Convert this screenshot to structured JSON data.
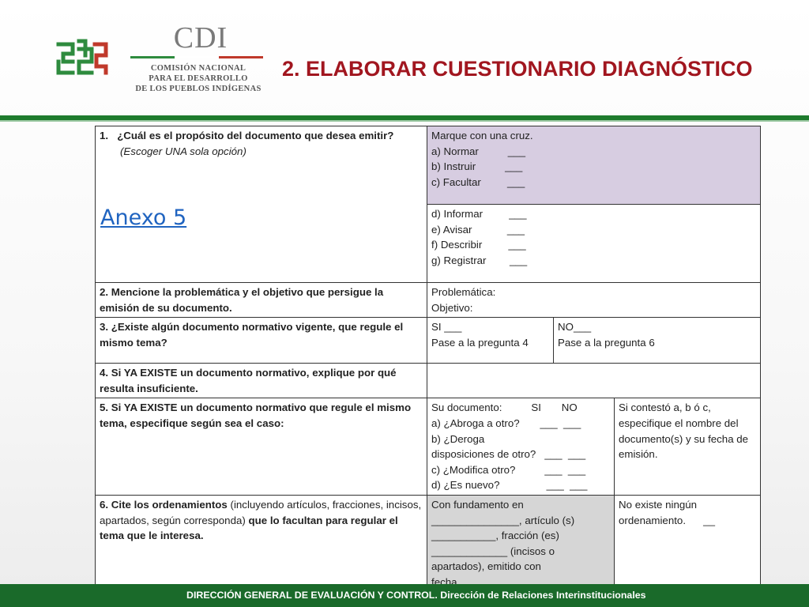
{
  "header": {
    "logo_title": "CDI",
    "logo_lines": [
      "COMISIÓN NACIONAL",
      "PARA EL DESARROLLO",
      "DE LOS PUEBLOS INDÍGENAS"
    ],
    "title": "2. ELABORAR  CUESTIONARIO DIAGNÓSTICO",
    "colors": {
      "title": "#a1161f",
      "band": "#1e7b2d",
      "logo_green": "#2e8b3e",
      "logo_red": "#c0392b"
    }
  },
  "icons": {
    "logo": "cdi-fret-logo-icon"
  },
  "q1": {
    "number": "1.",
    "question": "¿Cuál es el propósito del documento que desea emitir?",
    "note": "(Escoger UNA sola opción)",
    "link": "Anexo 5",
    "instruction": "Marque con una cruz.",
    "options_a": [
      "a) Normar          ___",
      "b) Instruir          ___",
      "c) Facultar         ___"
    ],
    "options_b": [
      "d) Informar         ___",
      "e) Avisar            ___",
      "f) Describir         ___",
      "g) Registrar        ___"
    ]
  },
  "q2": {
    "question": "2. Mencione la problemática y el objetivo que persigue la emisión de su documento.",
    "line1": "Problemática:",
    "line2": "Objetivo:"
  },
  "q3": {
    "question": "3. ¿Existe algún documento normativo vigente, que regule el mismo tema?",
    "yes": "SI ___",
    "yes_goto": "Pase a la pregunta 4",
    "no": "NO___",
    "no_goto": "Pase a la pregunta 6"
  },
  "q4": {
    "question": "4. Si YA EXISTE un documento normativo, explique por qué resulta insuficiente."
  },
  "q5": {
    "question": "5. Si YA EXISTE un documento normativo que regule el mismo tema, especifique según sea el caso:",
    "lines": [
      "Su documento:          SI       NO",
      "a) ¿Abroga a otro?       ___  ___",
      "b) ¿Deroga",
      "disposiciones de otro?   ___  ___",
      "c) ¿Modifica otro?          ___  ___",
      "d) ¿Es nuevo?                ___  ___"
    ],
    "note": "Si contestó a, b ó c, especifique el nombre del documento(s) y su fecha de emisión."
  },
  "q6": {
    "q_bold1": "6. Cite los ordenamientos",
    "q_normal": " (incluyendo artículos, fracciones, incisos, apartados, según corresponda)",
    "q_bold2": " que lo facultan para regular el tema que le interesa.",
    "lines": [
      "Con fundamento en",
      "_______________, artículo (s)",
      "___________, fracción (es)",
      "_____________ (incisos o",
      "apartados), emitido con",
      "fecha___________."
    ],
    "none": "No existe ningún ordenamiento.      __"
  },
  "footer": {
    "text": "DIRECCIÓN GENERAL DE  EVALUACIÓN Y CONTROL. Dirección de Relaciones Interinstitucionales"
  }
}
